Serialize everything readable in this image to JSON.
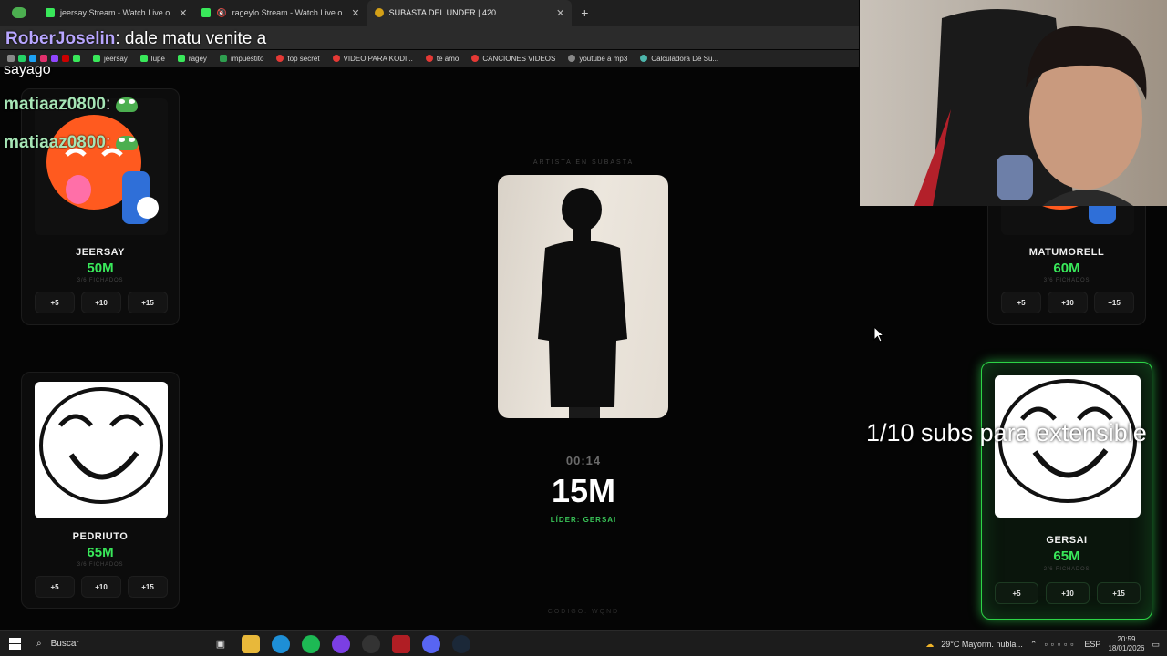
{
  "browser": {
    "tabs": [
      {
        "title": "jeersay Stream - Watch Live o",
        "muted": false,
        "active": false,
        "color": "#39e85a"
      },
      {
        "title": "rageylo Stream - Watch Live o",
        "muted": true,
        "active": false,
        "color": "#39e85a"
      },
      {
        "title": "SUBASTA DEL UNDER | 420",
        "muted": false,
        "active": true,
        "color": "#d4a017"
      }
    ],
    "new_tab": "+",
    "bookmarks": [
      "jeersay",
      "lupe",
      "ragey",
      "impuestito",
      "top secret",
      "VIDEO PARA KODI...",
      "te amo",
      "CANCIONES VIDEOS",
      "youtube a mp3",
      "Calculadora De Su..."
    ]
  },
  "chat": [
    {
      "user": "RoberJoselin",
      "message": ": dale matu venite a",
      "continuation": "sayago",
      "style": "purple"
    },
    {
      "user": "matiaaz0800",
      "message": ":",
      "style": "green"
    },
    {
      "user": "matiaaz0800",
      "message": ":",
      "style": "green"
    }
  ],
  "auction": {
    "label": "ARTISTA EN SUBASTA",
    "timer": "00:14",
    "current_bid": "15M",
    "leader": "LÍDER: GERSAI",
    "code": "CODIGO: WQND"
  },
  "players": [
    {
      "name": "JEERSAY",
      "money": "50M",
      "count": "3/6 FICHADOS",
      "buttons": [
        "+5",
        "+10",
        "+15"
      ]
    },
    {
      "name": "MATUMORELL",
      "money": "60M",
      "count": "3/6 FICHADOS",
      "buttons": [
        "+5",
        "+10",
        "+15"
      ]
    },
    {
      "name": "PEDRIUTO",
      "money": "65M",
      "count": "3/6 FICHADOS",
      "buttons": [
        "+5",
        "+10",
        "+15"
      ]
    },
    {
      "name": "GERSAI",
      "money": "65M",
      "count": "2/6 FICHADOS",
      "buttons": [
        "+5",
        "+10",
        "+15"
      ]
    }
  ],
  "overlay_text": "1/10 subs para extensible",
  "taskbar": {
    "search": "Buscar",
    "weather": "29°C  Mayorm. nubla...",
    "lang": "ESP",
    "time": "20:59",
    "date": "18/01/2026"
  },
  "colors": {
    "accent_green": "#39e85a",
    "leader_border": "#2dd446"
  }
}
